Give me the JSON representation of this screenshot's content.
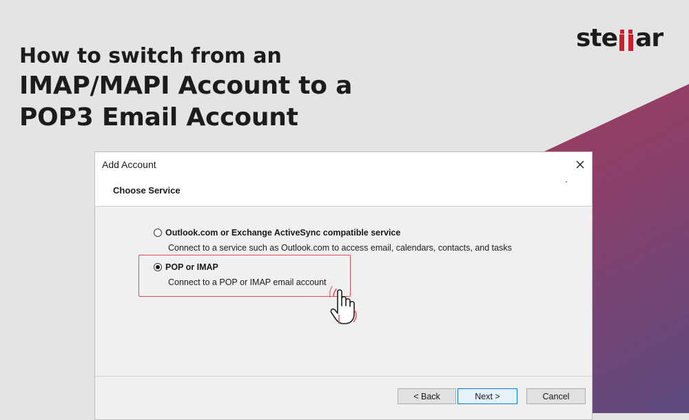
{
  "headline": {
    "line1": "How to switch from an",
    "line2": "IMAP/MAPI Account to a",
    "line3": "POP3 Email Account"
  },
  "brand": {
    "prefix": "ste",
    "suffix": "ar",
    "accent_color": "#c8202f"
  },
  "dialog": {
    "title": "Add Account",
    "section_title": "Choose Service",
    "options": [
      {
        "label": "Outlook.com or Exchange ActiveSync compatible service",
        "description": "Connect to a service such as Outlook.com to access email, calendars, contacts, and tasks",
        "selected": false
      },
      {
        "label": "POP or IMAP",
        "description": "Connect to a POP or IMAP email account",
        "selected": true
      }
    ],
    "buttons": {
      "back": "< Back",
      "next": "Next >",
      "cancel": "Cancel"
    }
  },
  "colors": {
    "background_gray": "#e4e4e4",
    "gradient_red": "#c4354c",
    "gradient_purple": "#5c4a80",
    "highlight_red": "#e04a55",
    "default_button_border": "#0078d7"
  },
  "icons": {
    "close": "close-icon",
    "cursor": "hand-pointer-icon"
  }
}
